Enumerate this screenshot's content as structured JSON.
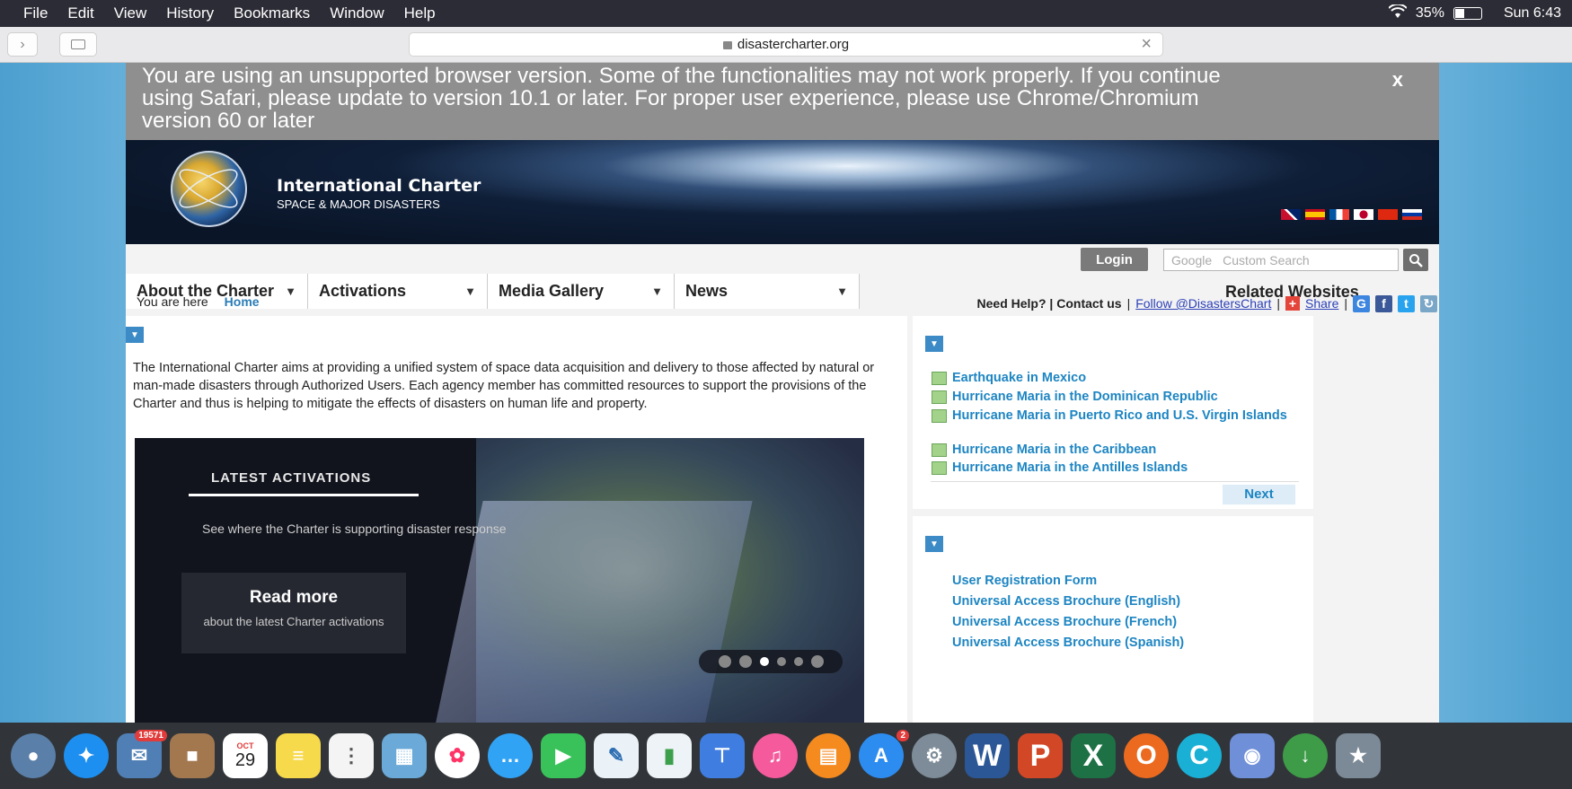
{
  "menubar": {
    "items": [
      "File",
      "Edit",
      "View",
      "History",
      "Bookmarks",
      "Window",
      "Help"
    ],
    "battery": "35%",
    "clock": "Sun 6:43"
  },
  "browser": {
    "url": "disastercharter.org"
  },
  "banner": {
    "text": "You are using an unsupported browser version. Some of the functionalities may not work properly. If you continue using Safari, please update to version 10.1 or later. For proper user experience, please use Chrome/Chromium version 60 or later",
    "close": "x"
  },
  "header": {
    "title": "International Charter",
    "subtitle": "SPACE & MAJOR DISASTERS",
    "login": "Login",
    "search_placeholder": "Custom Search",
    "search_brand": "Google"
  },
  "nav": {
    "items": [
      "About the Charter",
      "Activations",
      "Media Gallery",
      "News"
    ],
    "related": "Related Websites"
  },
  "breadcrumb": {
    "label": "You are here",
    "current": "Home"
  },
  "help": {
    "need_help": "Need Help? | Contact us",
    "follow": "Follow @DisastersChart",
    "share": "Share"
  },
  "intro": "The International Charter aims at providing a unified system of space data acquisition and delivery to those affected by natural or man-made disasters through Authorized Users. Each agency member has committed resources to support the provisions of the Charter and thus is helping to mitigate the effects of disasters on human life and property.",
  "slider": {
    "title": "LATEST ACTIVATIONS",
    "desc": "See where the Charter is supporting disaster response",
    "button": "Read more",
    "button_sub": "about the latest Charter activations"
  },
  "activations": {
    "items": [
      "Earthquake in Mexico",
      "Hurricane Maria in the Dominican Republic",
      "Hurricane Maria in Puerto Rico and U.S. Virgin Islands",
      "Hurricane Maria in the Caribbean",
      "Hurricane Maria in the Antilles Islands"
    ],
    "next": "Next"
  },
  "resources": {
    "items": [
      "User Registration Form",
      "Universal Access Brochure (English)",
      "Universal Access Brochure (French)",
      "Universal Access Brochure (Spanish)"
    ]
  },
  "dock": {
    "mail_badge": "19571",
    "calendar_month": "OCT",
    "calendar_day": "29",
    "appstore_badge": "2"
  }
}
